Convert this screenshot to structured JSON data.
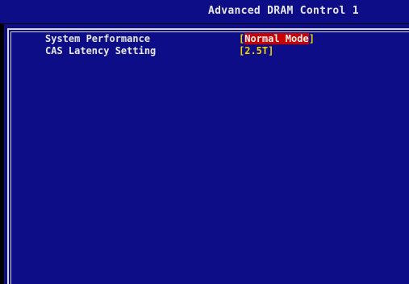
{
  "header": {
    "title": "Advanced DRAM Control 1"
  },
  "settings": [
    {
      "label": "System Performance",
      "value": "Normal Mode",
      "selected": true
    },
    {
      "label": "CAS Latency Setting",
      "value": "2.5T",
      "selected": false
    }
  ],
  "colors": {
    "background": "#0D0D88",
    "text": "#E8E8E8",
    "value": "#F2D200",
    "highlight": "#C80000",
    "border": "#D8D8D8"
  }
}
